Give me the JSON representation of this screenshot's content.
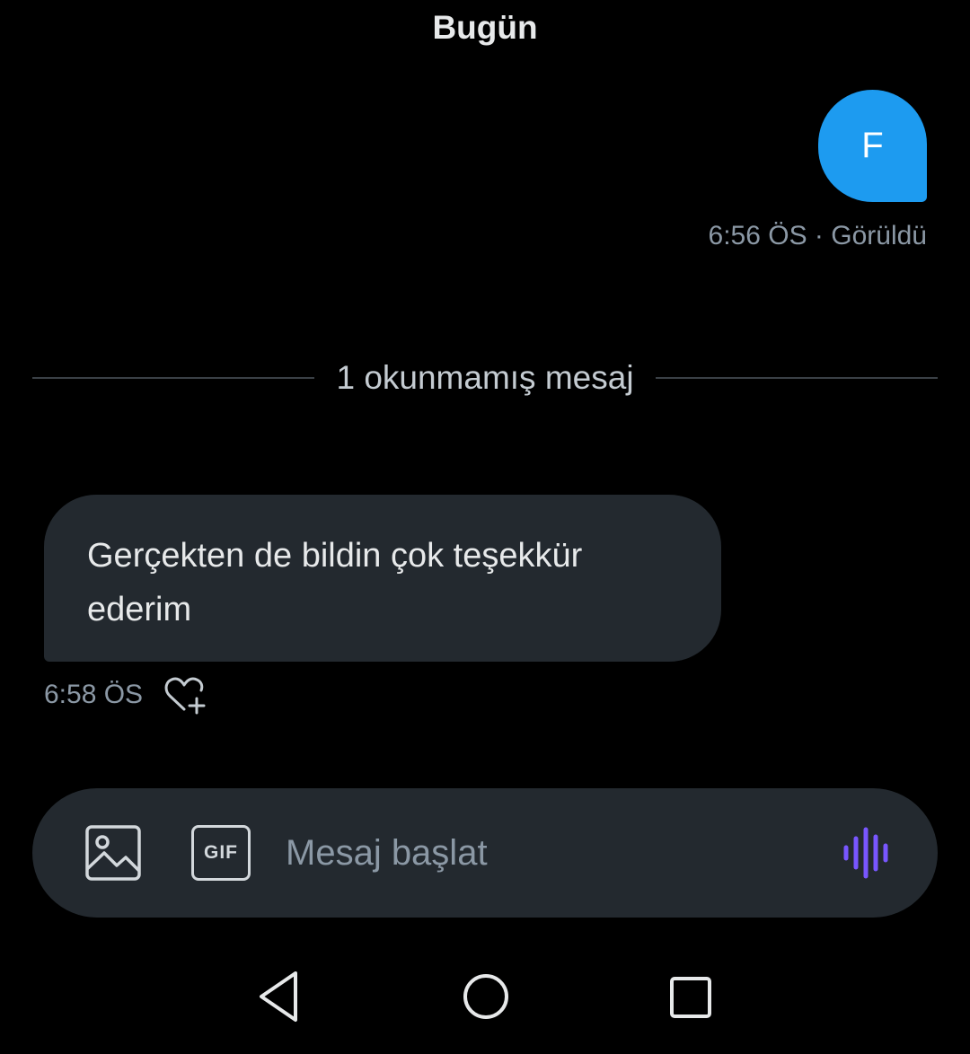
{
  "conversation": {
    "date_header": "Bugün",
    "sent_message": {
      "text": "F",
      "meta": "6:56 ÖS · Görüldü"
    },
    "unread_divider": "1 okunmamış mesaj",
    "received_message": {
      "text": "Gerçekten de bildin çok teşekkür ederim",
      "time": "6:58 ÖS"
    }
  },
  "composer": {
    "placeholder": "Mesaj başlat",
    "gif_label": "GIF",
    "icons": [
      "image-icon",
      "gif-icon",
      "voice-message-icon"
    ]
  },
  "navbar": {
    "icons": [
      "back-triangle-icon",
      "home-circle-icon",
      "recents-square-icon"
    ]
  },
  "colors": {
    "background": "#000000",
    "sent_bubble": "#1d9bf0",
    "received_bubble": "#23292f",
    "composer": "#23292f",
    "voice_accent": "#7856ff",
    "meta_text": "#8b98a5"
  }
}
